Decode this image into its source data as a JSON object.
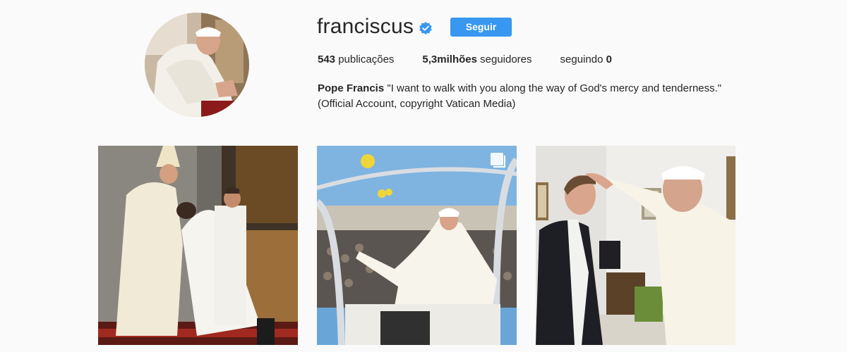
{
  "profile": {
    "username": "franciscus",
    "verified_icon": "verified-badge-icon",
    "follow_label": "Seguir",
    "stats": [
      {
        "value": "543",
        "label": " publicações"
      },
      {
        "value": "5,3milhões",
        "label": " seguidores"
      },
      {
        "label": "seguindo ",
        "value": "0"
      }
    ],
    "bio_name": "Pope Francis",
    "bio_text": " \"I want to walk with you along the way of God's mercy and tenderness.\"",
    "bio_line2": "(Official Account, copyright Vatican Media)"
  },
  "colors": {
    "background": "#fafafa",
    "accent": "#3897f0",
    "text": "#262626"
  }
}
